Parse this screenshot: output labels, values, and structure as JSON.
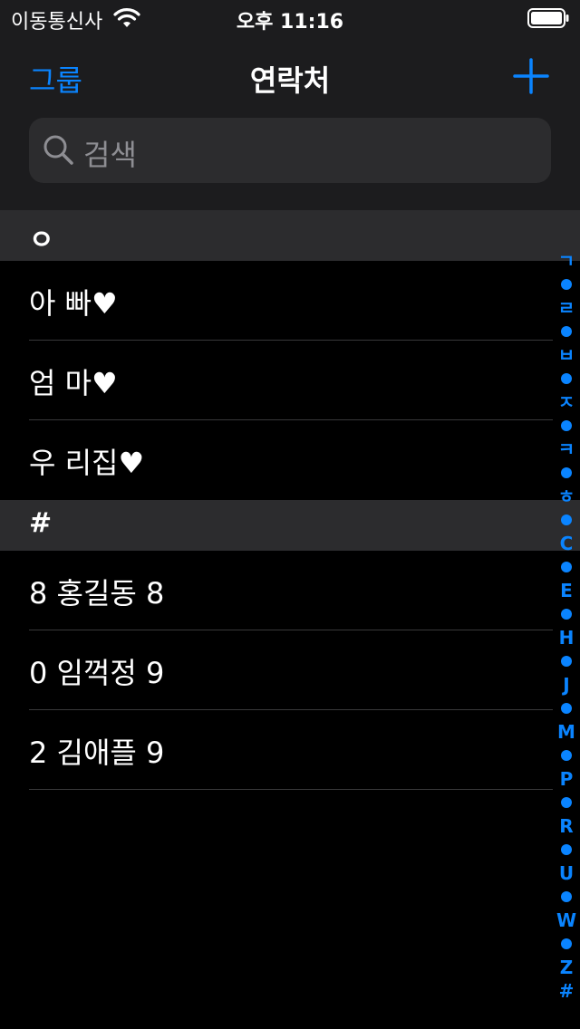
{
  "status_bar": {
    "carrier": "이동통신사",
    "time": "오후 11:16"
  },
  "nav": {
    "groups_label": "그룹",
    "title": "연락처"
  },
  "search": {
    "placeholder": "검색"
  },
  "sections": [
    {
      "header": "ㅇ",
      "contacts": [
        "아 빠♥",
        "엄 마♥",
        "우 리집♥"
      ]
    },
    {
      "header": "#",
      "contacts": [
        "8 홍길동 8",
        "0 임꺽정 9",
        "2 김애플 9"
      ]
    }
  ],
  "index_bar": [
    "ㄱ",
    "•",
    "ㄹ",
    "•",
    "ㅂ",
    "•",
    "ㅈ",
    "•",
    "ㅋ",
    "•",
    "ㅎ",
    "•",
    "C",
    "•",
    "E",
    "•",
    "H",
    "•",
    "J",
    "•",
    "M",
    "•",
    "P",
    "•",
    "R",
    "•",
    "U",
    "•",
    "W",
    "•",
    "Z",
    "#"
  ],
  "colors": {
    "accent": "#0a84ff",
    "background": "#000000",
    "header_background": "#1c1c1e",
    "section_background": "#2c2c2e"
  }
}
